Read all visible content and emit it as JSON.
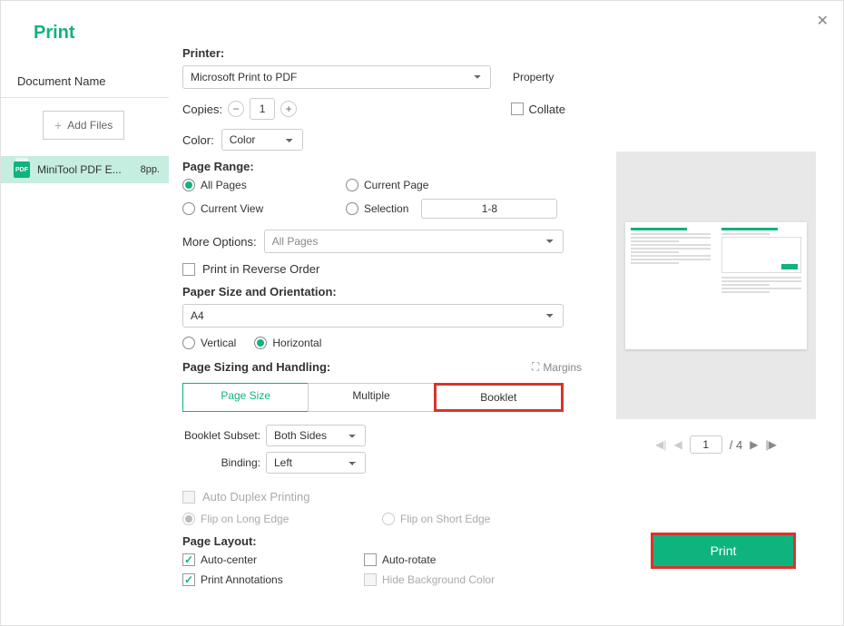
{
  "header": {
    "title": "Print"
  },
  "sidebar": {
    "docname_label": "Document Name",
    "add_files_label": "Add Files",
    "file": {
      "name": "MiniTool PDF E...",
      "pages": "8pp."
    }
  },
  "printer": {
    "label": "Printer:",
    "selected": "Microsoft Print to PDF",
    "property_label": "Property"
  },
  "copies": {
    "label": "Copies:",
    "value": "1",
    "collate_label": "Collate"
  },
  "color": {
    "label": "Color:",
    "selected": "Color"
  },
  "page_range": {
    "label": "Page Range:",
    "all": "All Pages",
    "current_page": "Current Page",
    "current_view": "Current View",
    "selection": "Selection",
    "selection_value": "1-8"
  },
  "more_options": {
    "label": "More Options:",
    "selected": "All Pages"
  },
  "reverse": {
    "label": "Print in Reverse Order"
  },
  "paper": {
    "label": "Paper Size and Orientation:",
    "selected": "A4",
    "vertical": "Vertical",
    "horizontal": "Horizontal"
  },
  "sizing": {
    "label": "Page Sizing and Handling:",
    "margins_label": "Margins",
    "tabs": {
      "page_size": "Page Size",
      "multiple": "Multiple",
      "booklet": "Booklet"
    }
  },
  "booklet": {
    "subset_label": "Booklet Subset:",
    "subset_value": "Both Sides",
    "binding_label": "Binding:",
    "binding_value": "Left",
    "auto_duplex": "Auto Duplex Printing",
    "flip_long": "Flip on Long Edge",
    "flip_short": "Flip on Short Edge"
  },
  "layout": {
    "label": "Page Layout:",
    "auto_center": "Auto-center",
    "auto_rotate": "Auto-rotate",
    "print_annotations": "Print Annotations",
    "hide_bg": "Hide Background Color"
  },
  "preview": {
    "page": "1",
    "total": "/ 4"
  },
  "actions": {
    "print": "Print"
  }
}
